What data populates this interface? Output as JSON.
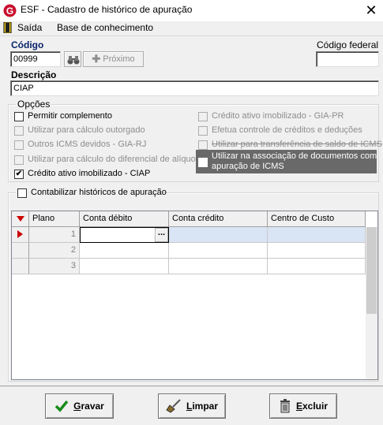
{
  "window": {
    "title": "ESF - Cadastro de histórico de apuração",
    "close": "✕"
  },
  "menu": {
    "items": [
      "Saída",
      "Base de conhecimento"
    ]
  },
  "form": {
    "codigo_label": "Código",
    "codigo_value": "00999",
    "proximo_label": "Próximo",
    "codigo_federal_label": "Código federal",
    "codigo_federal_value": "",
    "descricao_label": "Descrição",
    "descricao_value": "CIAP"
  },
  "opcoes": {
    "title": "Opções",
    "left": [
      {
        "label": "Permitir complemento",
        "checked": false,
        "enabled": true
      },
      {
        "label": "Utilizar para cálculo outorgado",
        "checked": false,
        "enabled": false
      },
      {
        "label": "Outros ICMS devidos - GIA-RJ",
        "checked": false,
        "enabled": false
      },
      {
        "label": "Utilizar para cálculo do diferencial de alíquota",
        "checked": false,
        "enabled": false
      },
      {
        "label": "Crédito ativo imobilizado - CIAP",
        "checked": true,
        "enabled": true
      }
    ],
    "right": [
      {
        "label": "Crédito ativo imobilizado - GIA-PR",
        "checked": false,
        "enabled": false
      },
      {
        "label": "Efetua controle de créditos e deduções",
        "checked": false,
        "enabled": false
      },
      {
        "label": "Utilizar para transferência de saldo de ICMS",
        "checked": false,
        "enabled": false
      }
    ],
    "highlight_line1": "Utilizar na associação de documentos com",
    "highlight_line2": "apuração de ICMS"
  },
  "contabilizar": {
    "label": "Contabilizar históricos de apuração",
    "checked": false
  },
  "grid": {
    "columns": [
      "Plano",
      "Conta débito",
      "Conta crédito",
      "Centro de Custo"
    ],
    "rows": [
      {
        "plano": "1",
        "conta_debito": "",
        "conta_credito": "",
        "centro_custo": ""
      },
      {
        "plano": "2",
        "conta_debito": "",
        "conta_credito": "",
        "centro_custo": ""
      },
      {
        "plano": "3",
        "conta_debito": "",
        "conta_credito": "",
        "centro_custo": ""
      }
    ],
    "ellipsis": "..."
  },
  "buttons": {
    "gravar_first": "G",
    "gravar_rest": "ravar",
    "limpar_first": "L",
    "limpar_rest": "impar",
    "excluir_first": "E",
    "excluir_rest": "xcluir"
  },
  "colors": {
    "accent_blue": "#0a246a",
    "red_marker": "#cc0000",
    "highlight": "#696969"
  }
}
